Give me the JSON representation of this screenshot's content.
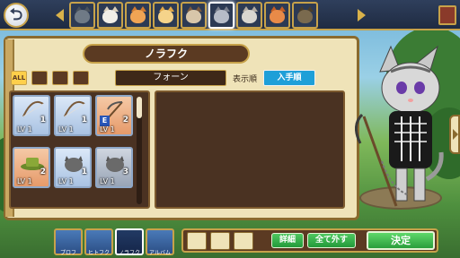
{
  "header": {
    "back_label": "⮌",
    "cats": [
      {
        "name": "cat-1",
        "fur": "#6f7a86",
        "ear": "#4a525c"
      },
      {
        "name": "cat-2",
        "fur": "#f2efe8",
        "ear": "#d9cdb8"
      },
      {
        "name": "cat-3",
        "fur": "#f0a454",
        "ear": "#d07a30"
      },
      {
        "name": "cat-4",
        "fur": "#f5d38a",
        "ear": "#e0a84a"
      },
      {
        "name": "cat-5",
        "fur": "#d8c6aa",
        "ear": "#7a5a40"
      },
      {
        "name": "cat-6",
        "fur": "#b6bcc8",
        "ear": "#7a808e"
      },
      {
        "name": "cat-7",
        "fur": "#d9d6d0",
        "ear": "#b2aaa0"
      },
      {
        "name": "cat-8",
        "fur": "#e88a48",
        "ear": "#c45e24"
      },
      {
        "name": "cat-9",
        "fur": "#7a6a4e",
        "ear": "#4a3e2a"
      }
    ]
  },
  "book": {
    "title": "ノラフク",
    "filters": [
      "ALL",
      "",
      "",
      ""
    ],
    "kind": "フォーン",
    "sort_label": "表示順",
    "sort_value": "入手順"
  },
  "items": [
    {
      "lv": "LV 1",
      "count": "1",
      "equipped": "",
      "style": "blue",
      "art": "bow"
    },
    {
      "lv": "LV 1",
      "count": "1",
      "equipped": "",
      "style": "blue",
      "art": "bow"
    },
    {
      "lv": "LV 1",
      "count": "2",
      "equipped": "E",
      "style": "orange",
      "art": "scythe"
    },
    {
      "lv": "LV 1",
      "count": "2",
      "equipped": "",
      "style": "orange",
      "art": "hat"
    },
    {
      "lv": "LV 1",
      "count": "1",
      "equipped": "",
      "style": "blue",
      "art": "cat"
    },
    {
      "lv": "LV 1",
      "count": "3",
      "equipped": "",
      "style": "grey",
      "art": "cat"
    }
  ],
  "nav": {
    "tabs": [
      "プロフ",
      "ヒトフク",
      "ノラフク",
      "アルバム"
    ],
    "selected": 2
  },
  "actions": {
    "detail": "詳細",
    "remove_all": "全て外す",
    "decide": "決定"
  },
  "colors": {
    "accent": "#1e9fd8",
    "frame": "#c7a24a",
    "panel": "#4a3222"
  }
}
